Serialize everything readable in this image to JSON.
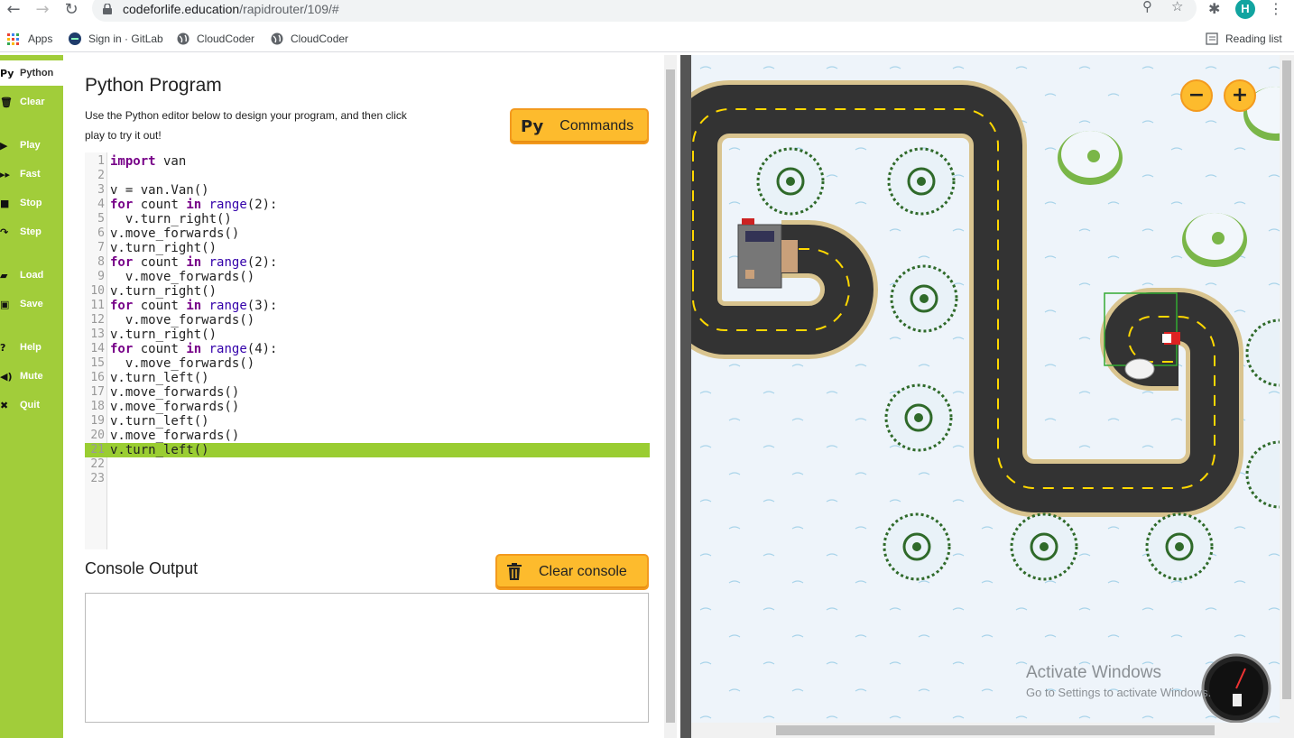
{
  "browser": {
    "url_host": "codeforlife.education",
    "url_path": "/rapidrouter/109/#",
    "avatar_letter": "H",
    "bookmarks": [
      {
        "label": "Apps",
        "icon": "apps-grid-icon"
      },
      {
        "label": "Sign in · GitLab",
        "icon": "gitlab-icon"
      },
      {
        "label": "CloudCoder",
        "icon": "globe-icon"
      },
      {
        "label": "CloudCoder",
        "icon": "globe-icon"
      }
    ],
    "reading_list": "Reading list"
  },
  "sidebar": {
    "items": [
      {
        "label": "Python",
        "icon": "Py"
      },
      {
        "label": "Clear",
        "icon": "trash-icon"
      },
      {
        "label": "Play",
        "icon": "play-icon"
      },
      {
        "label": "Fast",
        "icon": "fast-forward-icon"
      },
      {
        "label": "Stop",
        "icon": "stop-icon"
      },
      {
        "label": "Step",
        "icon": "step-icon"
      },
      {
        "label": "Load",
        "icon": "folder-icon"
      },
      {
        "label": "Save",
        "icon": "save-icon"
      },
      {
        "label": "Help",
        "icon": "help-icon"
      },
      {
        "label": "Mute",
        "icon": "speaker-icon"
      },
      {
        "label": "Quit",
        "icon": "close-icon"
      }
    ]
  },
  "editor_panel": {
    "title": "Python Program",
    "description": "Use the Python editor below to design your program, and then click play to try it out!",
    "commands_button": "Commands",
    "commands_prefix": "Py",
    "active_line": 21,
    "code_lines": [
      "import van",
      "",
      "v = van.Van()",
      "for count in range(2):",
      "  v.turn_right()",
      "v.move_forwards()",
      "v.turn_right()",
      "for count in range(2):",
      "  v.move_forwards()",
      "v.turn_right()",
      "for count in range(3):",
      "  v.move_forwards()",
      "v.turn_right()",
      "for count in range(4):",
      "  v.move_forwards()",
      "v.turn_left()",
      "v.move_forwards()",
      "v.move_forwards()",
      "v.turn_left()",
      "v.move_forwards()",
      "v.turn_left()",
      "",
      ""
    ],
    "console_title": "Console Output",
    "clear_console_button": "Clear console"
  },
  "map": {
    "zoom_out": "−",
    "zoom_in": "+",
    "watermark_title": "Activate Windows",
    "watermark_sub": "Go to Settings to activate Windows."
  },
  "colors": {
    "sidebar_green": "#a1cd3a",
    "active_line": "#9acd32",
    "button_orange": "#fdbb2d",
    "road": "#333333",
    "road_edge": "#d9c48f",
    "lane_marking": "#ffd800"
  }
}
